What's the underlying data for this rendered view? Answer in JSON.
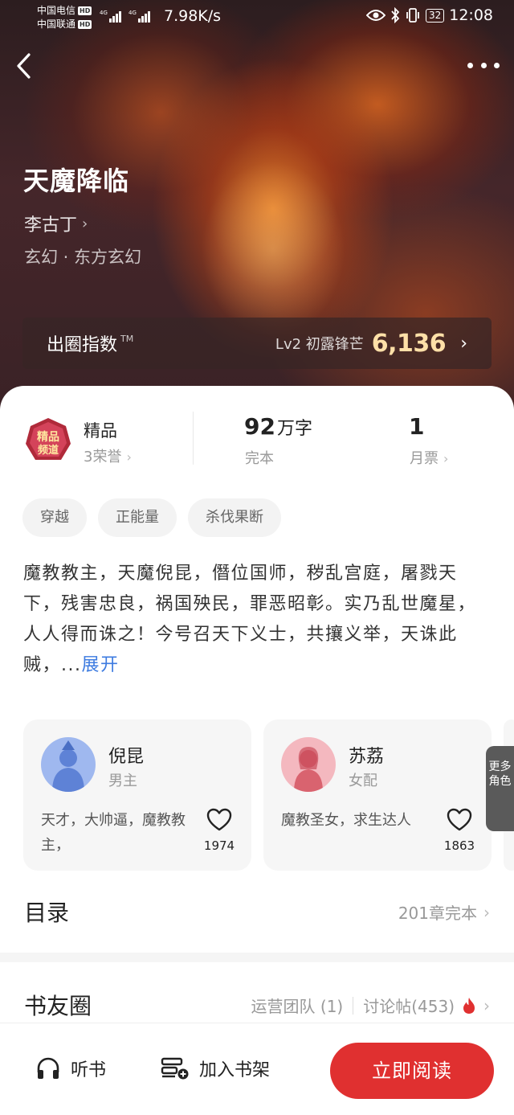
{
  "status_bar": {
    "carrier1": "中国电信",
    "carrier2": "中国联通",
    "hd": "HD",
    "net1": "4G",
    "net2": "4G",
    "speed": "7.98K/s",
    "battery": "32",
    "time": "12:08"
  },
  "book": {
    "title": "天魔降临",
    "author": "李古丁",
    "genre": "玄幻 · 东方玄幻"
  },
  "index": {
    "label": "出圈指数",
    "tm": "TM",
    "level": "Lv2 初露锋芒",
    "value": "6,136"
  },
  "stats": {
    "honor_title": "精品",
    "honor_sub": "3荣誉",
    "words_num": "92",
    "words_unit": "万字",
    "words_sub": "完本",
    "votes_num": "1",
    "votes_sub": "月票",
    "badge_text_1": "精品",
    "badge_text_2": "频道"
  },
  "tags": [
    "穿越",
    "正能量",
    "杀伐果断"
  ],
  "synopsis": {
    "text": "魔教教主，天魔倪昆，僭位国师，秽乱宫庭，屠戮天下，残害忠良，祸国殃民，罪恶昭彰。实乃乱世魔星，人人得而诛之！今号召天下义士，共攘义举，天诛此贼，...",
    "expand": "展开"
  },
  "characters": [
    {
      "name": "倪昆",
      "role": "男主",
      "desc": "天才，大帅逼，魔教教主，",
      "likes": "1974"
    },
    {
      "name": "苏荔",
      "role": "女配",
      "desc": "魔教圣女，求生达人",
      "likes": "1863"
    }
  ],
  "more_roles": "更多角色",
  "toc": {
    "title": "目录",
    "info": "201章完本"
  },
  "circle": {
    "title": "书友圈",
    "team": "运营团队 (1)",
    "posts": "讨论帖(453)"
  },
  "bottom": {
    "listen": "听书",
    "shelf": "加入书架",
    "read": "立即阅读"
  },
  "colors": {
    "accent": "#e03030",
    "link": "#3d7be0",
    "index_value": "#ffe0a8"
  }
}
